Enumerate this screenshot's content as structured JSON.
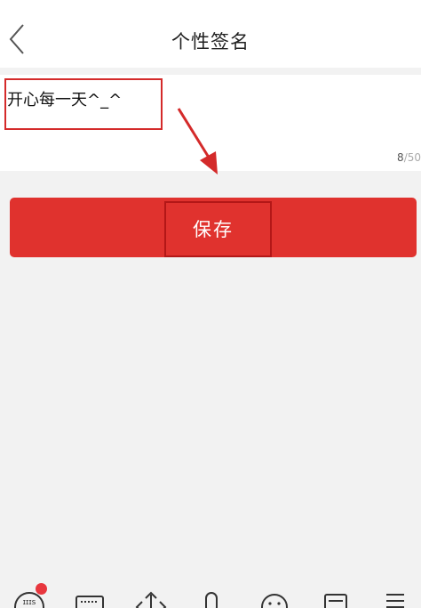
{
  "header": {
    "title": "个性签名"
  },
  "signature": {
    "value": "开心每一天^_^",
    "count": "8",
    "max": "/50"
  },
  "save": {
    "label": "保存"
  },
  "icons": {
    "back": "chevron-left-icon",
    "keyboard_toolbar": [
      "emoji-keyboard-icon",
      "keyboard-icon",
      "cursor-move-icon",
      "microphone-icon",
      "smiley-icon",
      "clipboard-icon",
      "menu-icon"
    ]
  },
  "colors": {
    "accent": "#e0322e",
    "annotation": "#d42a2a",
    "background": "#f2f2f2"
  }
}
